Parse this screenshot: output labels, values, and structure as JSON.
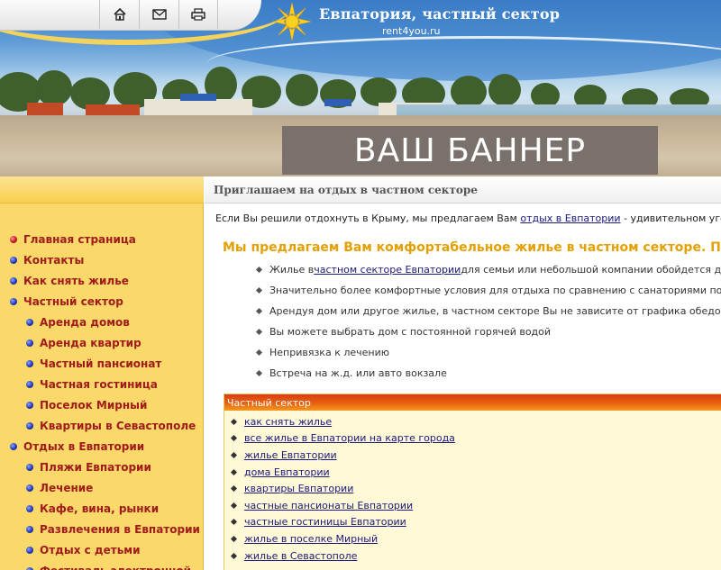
{
  "header": {
    "site_title": "Евпатория, частный сектор",
    "site_domain": "rent4you.ru",
    "icons": [
      "home-icon",
      "mail-icon",
      "print-icon"
    ],
    "banner_ad": "ВАШ БАННЕР"
  },
  "sidebar": {
    "items": [
      {
        "label": "Главная страница",
        "level": 0,
        "active": true
      },
      {
        "label": "Контакты",
        "level": 0
      },
      {
        "label": "Как снять жилье",
        "level": 0
      },
      {
        "label": "Частный сектор",
        "level": 0
      },
      {
        "label": "Аренда домов",
        "level": 1
      },
      {
        "label": "Аренда квартир",
        "level": 1
      },
      {
        "label": "Частный пансионат",
        "level": 1
      },
      {
        "label": "Частная гостиница",
        "level": 1
      },
      {
        "label": "Поселок Мирный",
        "level": 1
      },
      {
        "label": "Квартиры в Севастополе",
        "level": 1
      },
      {
        "label": "Отдых в Евпатории",
        "level": 0
      },
      {
        "label": "Пляжи Евпатории",
        "level": 1
      },
      {
        "label": "Лечение",
        "level": 1
      },
      {
        "label": "Кафе, вина, рынки",
        "level": 1
      },
      {
        "label": "Развлечения в Евпатории",
        "level": 1
      },
      {
        "label": "Отдых с детьми",
        "level": 1
      },
      {
        "label": "Фестиваль электронной",
        "level": 1
      }
    ]
  },
  "main": {
    "heading": "Приглашаем на отдых в частном секторе",
    "intro": {
      "before": "Если Вы решили отдохнуть в Крыму, мы предлагаем Вам ",
      "link": "отдых в Евпатории",
      "after": " - удивительном уголке Крыма,"
    },
    "offer_title": "Мы предлагаем Вам комфортабельное жилье в частном секторе. Потому",
    "benefits": [
      {
        "before": "Жилье в ",
        "link": "частном секторе Евпатории",
        "after": " для семьи или небольшой компании обойдется дешевле,"
      },
      {
        "text": "Значительно более комфортные условия для отдыха по сравнению с санаториями по сопостав"
      },
      {
        "text": "Арендуя дом или другое жилье, в частном секторе Вы не зависите от графика обедов, ужинов"
      },
      {
        "text": "Вы можете выбрать дом с постоянной горячей водой"
      },
      {
        "text": "Непривязка к лечению"
      },
      {
        "text": "Встреча на ж.д. или авто вокзале"
      }
    ],
    "box": {
      "title": "Частный сектор",
      "links": [
        "как снять жилье",
        "все жилье в Евпатории на карте города",
        "жилье Евпатории",
        "дома Евпатории",
        "квартиры Евпатории",
        "частные пансионаты Евпатории",
        "частные гостиницы Евпатории",
        "жилье в поселке Мирный",
        "жилье в Севастополе"
      ]
    }
  },
  "colors": {
    "sidebar_bg": "#fad96a",
    "menu_link": "#a11b1b",
    "offer_title": "#e3a000",
    "box_header": "#e8620f",
    "banner_ad_bg": "#7b716c"
  }
}
